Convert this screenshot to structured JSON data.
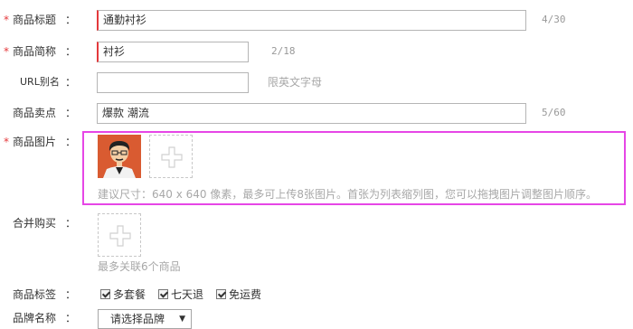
{
  "form": {
    "title": {
      "required": "*",
      "label": "商品标题",
      "colon": "：",
      "value": "通勤衬衫",
      "counter": "4/30"
    },
    "short_name": {
      "required": "*",
      "label": "商品简称",
      "colon": "：",
      "value": "衬衫",
      "counter": "2/18"
    },
    "url_alias": {
      "label": "URL别名",
      "colon": "：",
      "value": "",
      "hint": "限英文字母"
    },
    "selling_points": {
      "label": "商品卖点",
      "colon": "：",
      "value": "爆款 潮流",
      "counter": "5/60"
    },
    "images": {
      "required": "*",
      "label": "商品图片",
      "colon": "：",
      "hint": "建议尺寸：640 x 640 像素，最多可上传8张图片。首张为列表缩列图，您可以拖拽图片调整图片顺序。",
      "thumbnail_icon": "man-avatar-icon",
      "upload_icon": "plus-icon"
    },
    "bundle": {
      "label": "合并购买",
      "colon": "：",
      "hint": "最多关联6个商品",
      "upload_icon": "plus-icon"
    },
    "tags": {
      "label": "商品标签",
      "colon": "：",
      "options": [
        {
          "label": "多套餐",
          "checked": true
        },
        {
          "label": "七天退",
          "checked": true
        },
        {
          "label": "免运费",
          "checked": true
        }
      ]
    },
    "brand": {
      "label": "品牌名称",
      "colon": "：",
      "selected": "请选择品牌"
    }
  },
  "colors": {
    "required": "#e4393c",
    "highlight": "#e646e6",
    "hint": "#a8a8a8"
  }
}
